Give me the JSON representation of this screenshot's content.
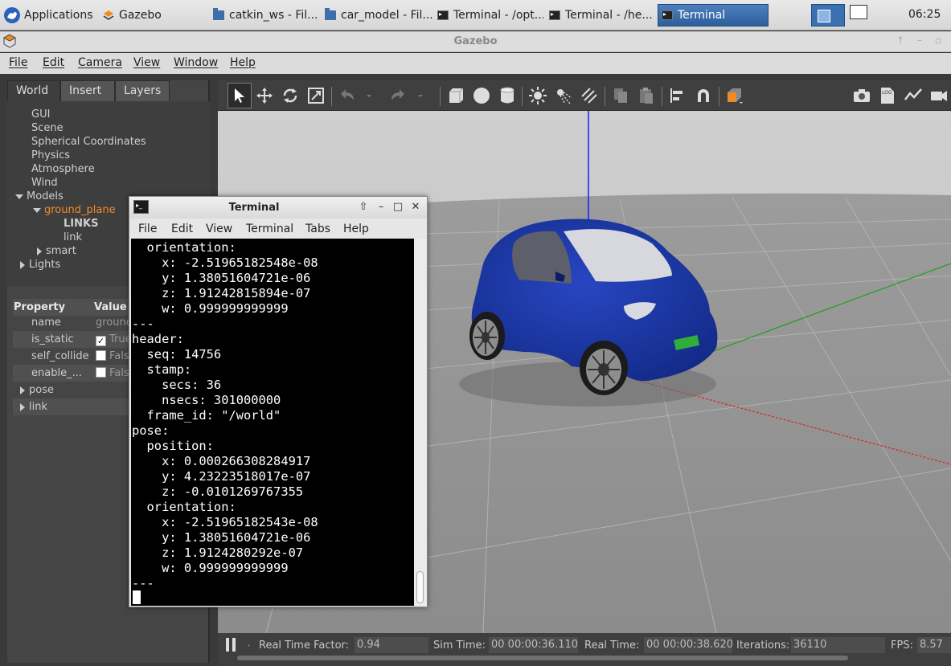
{
  "panel": {
    "applications_label": "Applications",
    "tasks": [
      {
        "label": "Gazebo"
      },
      {
        "label": "catkin_ws - Fil..."
      },
      {
        "label": "car_model - Fil..."
      },
      {
        "label": "Terminal - /opt..."
      },
      {
        "label": "Terminal - /he..."
      },
      {
        "label": "Terminal"
      }
    ],
    "clock": "06:25"
  },
  "gazebo": {
    "title": "Gazebo",
    "menu": [
      "File",
      "Edit",
      "Camera",
      "View",
      "Window",
      "Help"
    ],
    "tabs": [
      "World",
      "Insert",
      "Layers"
    ],
    "tree": {
      "gui": "GUI",
      "scene": "Scene",
      "spherical": "Spherical Coordinates",
      "physics": "Physics",
      "atmosphere": "Atmosphere",
      "wind": "Wind",
      "models": "Models",
      "ground_plane": "ground_plane",
      "links_header": "LINKS",
      "link": "link",
      "smart": "smart",
      "lights": "Lights"
    },
    "properties": {
      "col_property": "Property",
      "col_value": "Value",
      "rows": [
        {
          "name": "name",
          "value": "ground_plane"
        },
        {
          "name": "is_static",
          "value": "True",
          "checked": true
        },
        {
          "name": "self_collide",
          "value": "False",
          "checked": false
        },
        {
          "name": "enable_...",
          "value": "False",
          "checked": false
        }
      ],
      "pose": "pose",
      "link": "link"
    },
    "status": {
      "rtf_label": "Real Time Factor:",
      "rtf_value": "0.94",
      "sim_label": "Sim Time:",
      "sim_value": "00 00:00:36.110",
      "real_label": "Real Time:",
      "real_value": "00 00:00:38.620",
      "iter_label": "Iterations:",
      "iter_value": "36110",
      "fps_label": "FPS:",
      "fps_value": "8.57"
    },
    "colors": {
      "car_body": "#1d3aa8",
      "ground": "#9a9a9a",
      "sky": "#c8c8c8",
      "selection": "#f08a24"
    }
  },
  "terminal": {
    "title": "Terminal",
    "menu": [
      "File",
      "Edit",
      "View",
      "Terminal",
      "Tabs",
      "Help"
    ],
    "lines": [
      "  orientation:",
      "    x: -2.51965182548e-08",
      "    y: 1.38051604721e-06",
      "    z: 1.91242815894e-07",
      "    w: 0.999999999999",
      "---",
      "header:",
      "  seq: 14756",
      "  stamp:",
      "    secs: 36",
      "    nsecs: 301000000",
      "  frame_id: \"/world\"",
      "pose:",
      "  position:",
      "    x: 0.000266308284917",
      "    y: 4.23223518017e-07",
      "    z: -0.0101269767355",
      "  orientation:",
      "    x: -2.51965182543e-08",
      "    y: 1.38051604721e-06",
      "    z: 1.9124280292e-07",
      "    w: 0.999999999999",
      "---"
    ]
  }
}
